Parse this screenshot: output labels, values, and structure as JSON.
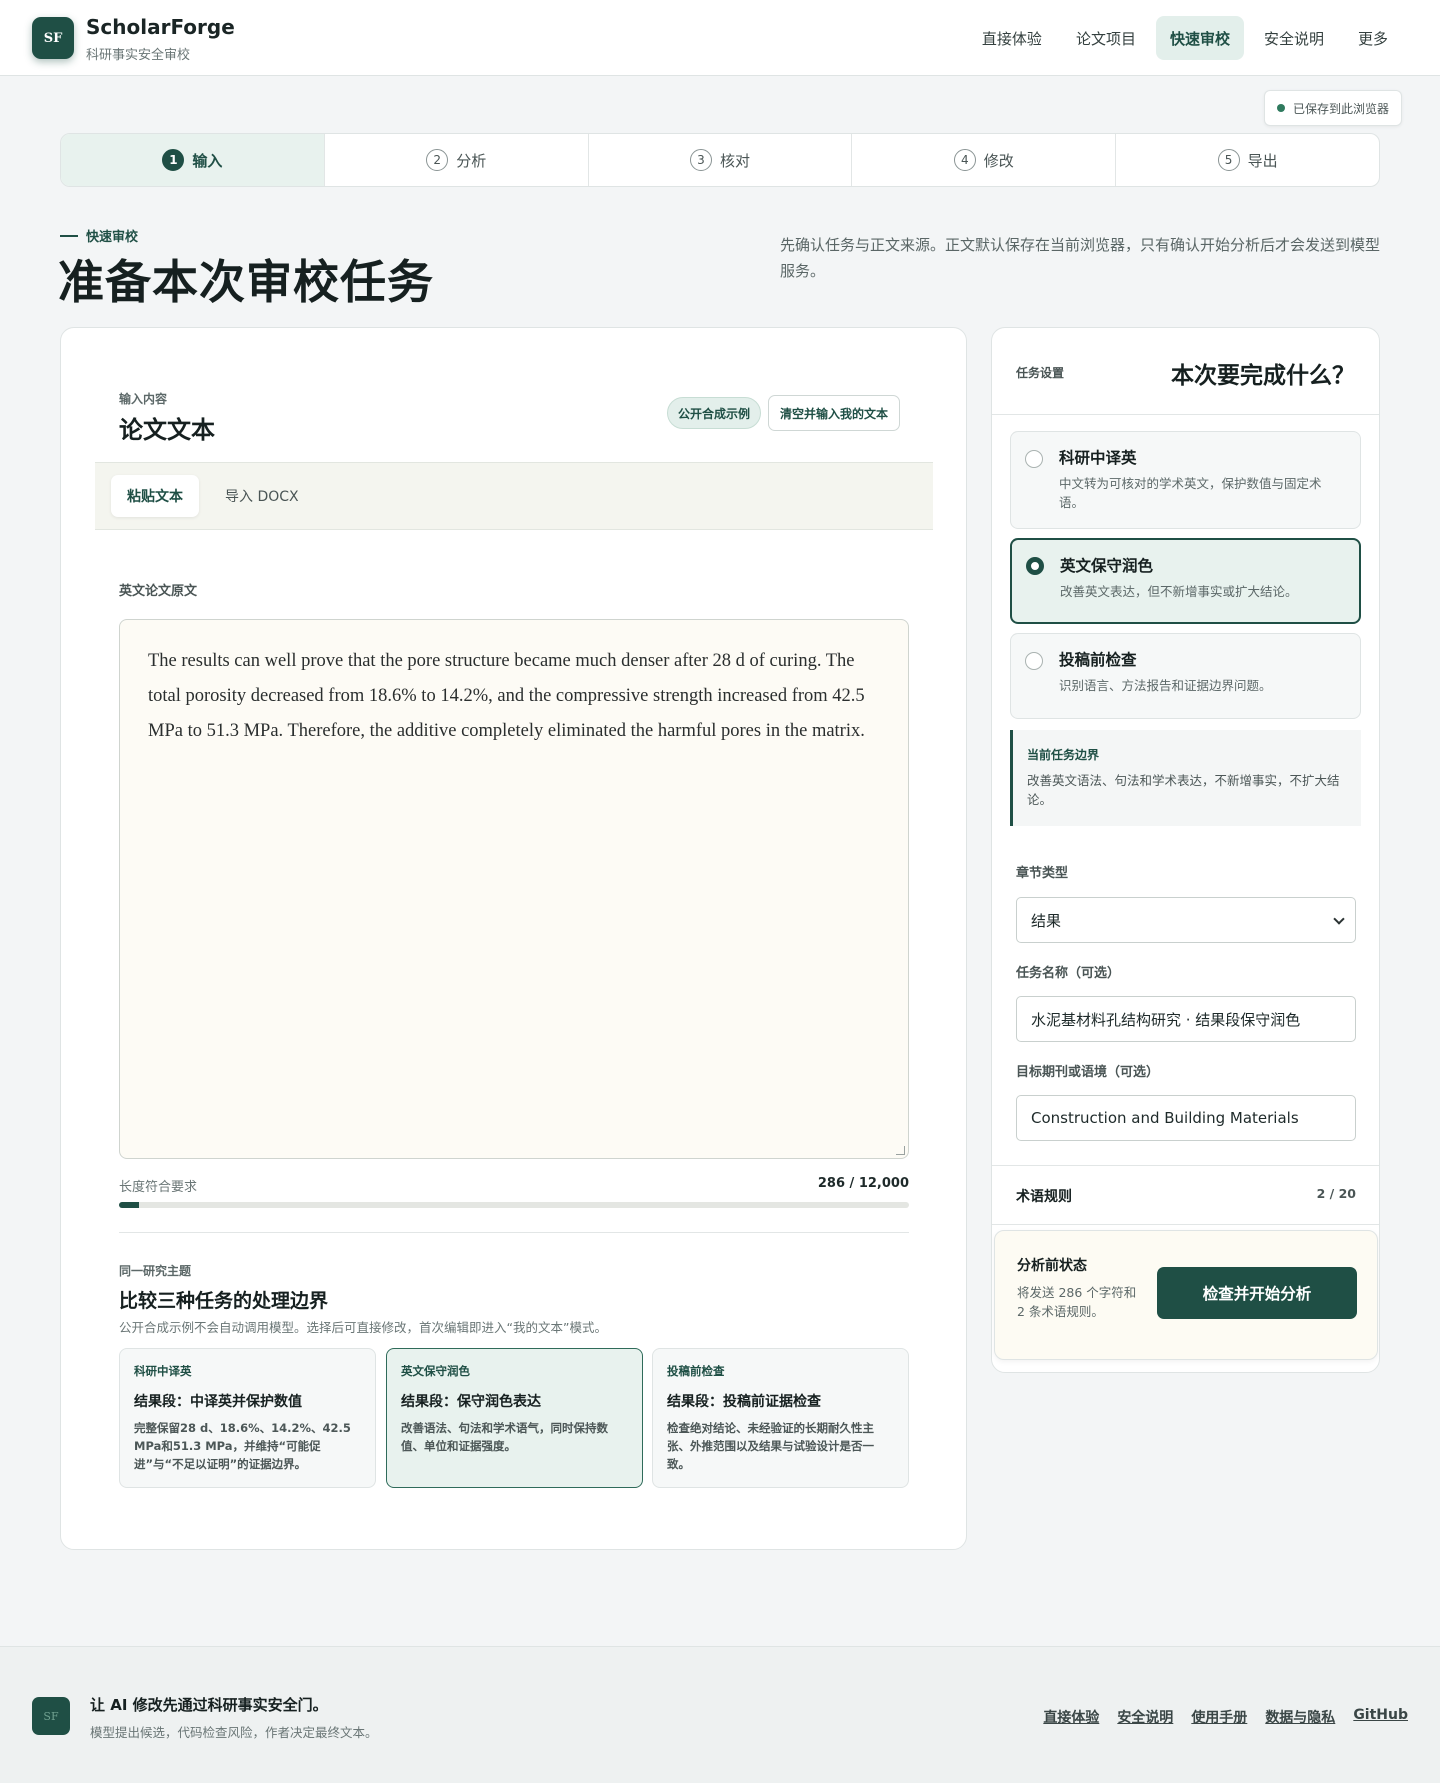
{
  "header": {
    "logo_text": "SF",
    "brand_name": "ScholarForge",
    "brand_sub": "科研事实安全审校",
    "nav": [
      {
        "label": "直接体验"
      },
      {
        "label": "论文项目"
      },
      {
        "label": "快速审校"
      },
      {
        "label": "安全说明"
      },
      {
        "label": "更多"
      }
    ],
    "active_nav": "快速审校"
  },
  "save_badge": "已保存到此浏览器",
  "stepper": [
    {
      "num": "1",
      "label": "输入"
    },
    {
      "num": "2",
      "label": "分析"
    },
    {
      "num": "3",
      "label": "核对"
    },
    {
      "num": "4",
      "label": "修改"
    },
    {
      "num": "5",
      "label": "导出"
    }
  ],
  "page": {
    "eyebrow": "快速审校",
    "title": "准备本次审校任务",
    "desc": "先确认任务与正文来源。正文默认保存在当前浏览器，只有确认开始分析后才会发送到模型服务。"
  },
  "input_section": {
    "eyebrow": "输入内容",
    "title": "论文文本",
    "sample_chip": "公开合成示例",
    "clear_button": "清空并输入我的文本",
    "tabs": [
      {
        "label": "粘贴文本"
      },
      {
        "label": "导入 DOCX"
      }
    ],
    "field_label": "英文论文原文",
    "text": "The results can well prove that the pore structure became much denser after 28 d of curing. The total porosity decreased from 18.6% to 14.2%, and the compressive strength increased from 42.5 MPa to 51.3 MPa. Therefore, the additive completely eliminated the harmful pores in the matrix.",
    "length_label": "长度符合要求",
    "length_count": "286 / 12,000",
    "length_value": 286,
    "length_max": 12000
  },
  "compare": {
    "eyebrow": "同一研究主题",
    "title": "比较三种任务的处理边界",
    "sub": "公开合成示例不会自动调用模型。选择后可直接修改，首次编辑即进入“我的文本”模式。",
    "cards": [
      {
        "tag": "科研中译英",
        "title": "结果段：中译英并保护数值",
        "desc": "完整保留28 d、18.6%、14.2%、42.5 MPa和51.3 MPa，并维持“可能促进”与“不足以证明”的证据边界。"
      },
      {
        "tag": "英文保守润色",
        "title": "结果段：保守润色表达",
        "desc": "改善语法、句法和学术语气，同时保持数值、单位和证据强度。"
      },
      {
        "tag": "投稿前检查",
        "title": "结果段：投稿前证据检查",
        "desc": "检查绝对结论、未经验证的长期耐久性主张、外推范围以及结果与试验设计是否一致。"
      }
    ]
  },
  "task": {
    "eyebrow": "任务设置",
    "title": "本次要完成什么？",
    "options": [
      {
        "title": "科研中译英",
        "desc": "中文转为可核对的学术英文，保护数值与固定术语。"
      },
      {
        "title": "英文保守润色",
        "desc": "改善英文表达，但不新增事实或扩大结论。"
      },
      {
        "title": "投稿前检查",
        "desc": "识别语言、方法报告和证据边界问题。"
      }
    ],
    "selected": "英文保守润色",
    "boundary_title": "当前任务边界",
    "boundary_desc": "改善英文语法、句法和学术表达，不新增事实，不扩大结论。",
    "section_type_label": "章节类型",
    "section_type_value": "结果",
    "task_name_label": "任务名称（可选）",
    "task_name_value": "水泥基材料孔结构研究 · 结果段保守润色",
    "journal_label": "目标期刊或语境（可选）",
    "journal_value": "Construction and Building Materials",
    "term_label": "术语规则",
    "term_count": "2 / 20",
    "status_title": "分析前状态",
    "status_desc": "将发送 286 个字符和 2 条术语规则。",
    "start_button": "检查并开始分析"
  },
  "footer": {
    "logo_text": "SF",
    "title": "让 AI 修改先通过科研事实安全门。",
    "sub": "模型提出候选，代码检查风险，作者决定最终文本。",
    "links": [
      {
        "label": "直接体验"
      },
      {
        "label": "安全说明"
      },
      {
        "label": "使用手册"
      },
      {
        "label": "数据与隐私"
      },
      {
        "label": "GitHub"
      }
    ]
  },
  "colors": {
    "accent": "#1f4f45",
    "accent_soft": "#e8f2ee",
    "page_bg": "#f3f5f6"
  }
}
